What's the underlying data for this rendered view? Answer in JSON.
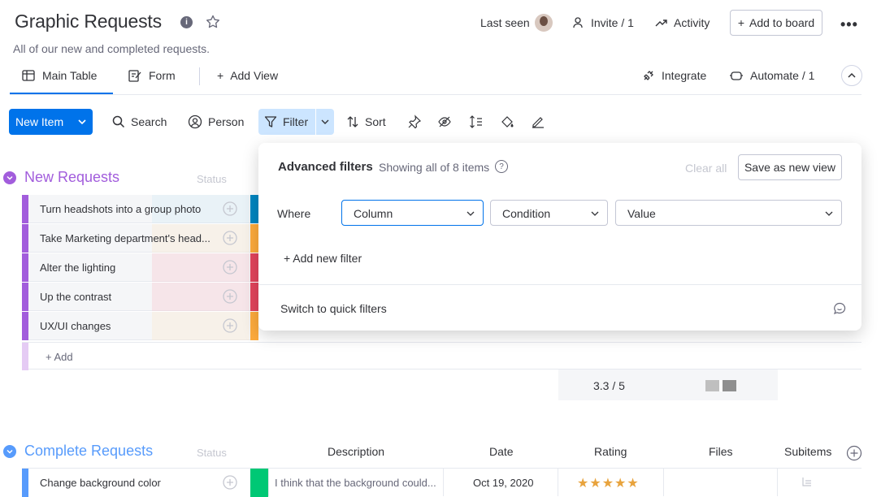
{
  "board": {
    "title": "Graphic Requests",
    "description": "All of our new and completed requests."
  },
  "header": {
    "last_seen": "Last seen",
    "invite": "Invite / 1",
    "activity": "Activity",
    "add_to_board": "Add to board"
  },
  "views": {
    "tabs": [
      {
        "label": "Main Table",
        "icon": "table-icon",
        "active": true
      },
      {
        "label": "Form",
        "icon": "form-icon",
        "active": false
      }
    ],
    "add_view": "Add View",
    "integrate": "Integrate",
    "automate": "Automate / 1"
  },
  "toolbar": {
    "new_item": "New Item",
    "search": "Search",
    "person": "Person",
    "filter": "Filter",
    "sort": "Sort"
  },
  "groups": [
    {
      "title": "New Requests",
      "color": "#a25ddc",
      "faded_column": "Status",
      "items": [
        {
          "name": "Turn headshots into a group photo",
          "status_color": "#0086c0"
        },
        {
          "name": "Take Marketing department's head...",
          "status_color": "#fdab3d"
        },
        {
          "name": "Alter the lighting",
          "status_color": "#e2445c"
        },
        {
          "name": "Up the contrast",
          "status_color": "#e2445c"
        },
        {
          "name": "UX/UI changes",
          "status_color": "#fdab3d"
        }
      ],
      "add_label": "+ Add",
      "summary_rating": "3.3  / 5"
    },
    {
      "title": "Complete Requests",
      "color": "#579bfc",
      "faded_column": "Status",
      "columns": [
        "Description",
        "Date",
        "Rating",
        "Files",
        "Subitems"
      ],
      "items": [
        {
          "name": "Change background color",
          "status_color": "#00c875",
          "description": "I think that the background could...",
          "date": "Oct 19, 2020",
          "rating": "★★★★★"
        }
      ]
    }
  ],
  "filter_popup": {
    "title": "Advanced filters",
    "subtitle": "Showing all of 8 items",
    "clear_all": "Clear all",
    "save_view": "Save as new view",
    "where": "Where",
    "column": "Column",
    "condition": "Condition",
    "value": "Value",
    "add_filter": "+ Add new filter",
    "quick_filters": "Switch to quick filters"
  }
}
